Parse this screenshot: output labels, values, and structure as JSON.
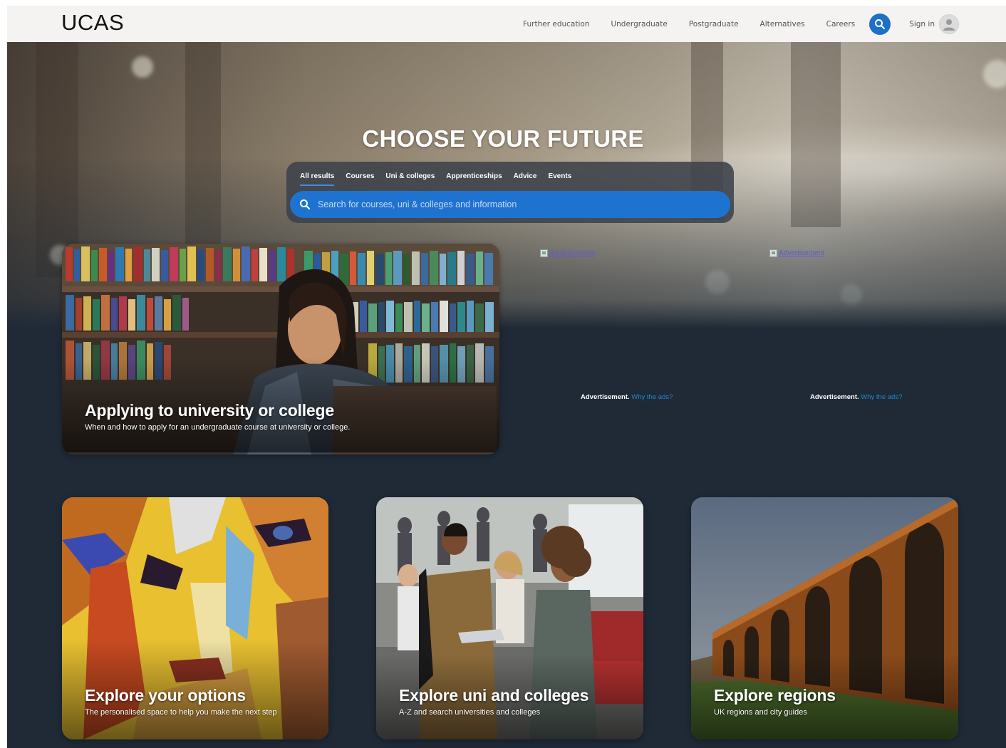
{
  "header": {
    "logo": "UCAS",
    "nav": [
      "Further education",
      "Undergraduate",
      "Postgraduate",
      "Alternatives",
      "Careers"
    ],
    "signin_label": "Sign in"
  },
  "hero": {
    "title": "CHOOSE YOUR FUTURE",
    "tabs": [
      "All results",
      "Courses",
      "Uni & colleges",
      "Apprenticeships",
      "Advice",
      "Events"
    ],
    "active_tab": "All results",
    "search_placeholder": "Search for courses, uni & colleges and information"
  },
  "featured_card": {
    "title": "Applying to university or college",
    "subtitle": "When and how to apply for an undergraduate course at university or college."
  },
  "ads": [
    {
      "alt": "Advertisement",
      "label": "Advertisement.",
      "why": "Why the ads?"
    },
    {
      "alt": "Advertisement",
      "label": "Advertisement.",
      "why": "Why the ads?"
    }
  ],
  "cards": [
    {
      "title": "Explore your options",
      "subtitle": "The personalised space to help you make the next step"
    },
    {
      "title": "Explore uni and colleges",
      "subtitle": "A-Z and search universities and colleges"
    },
    {
      "title": "Explore regions",
      "subtitle": "UK regions and city guides"
    }
  ],
  "colors": {
    "accent": "#1f73d0",
    "background_dark": "#1f2a36",
    "header_bg": "#f4f3f1"
  }
}
